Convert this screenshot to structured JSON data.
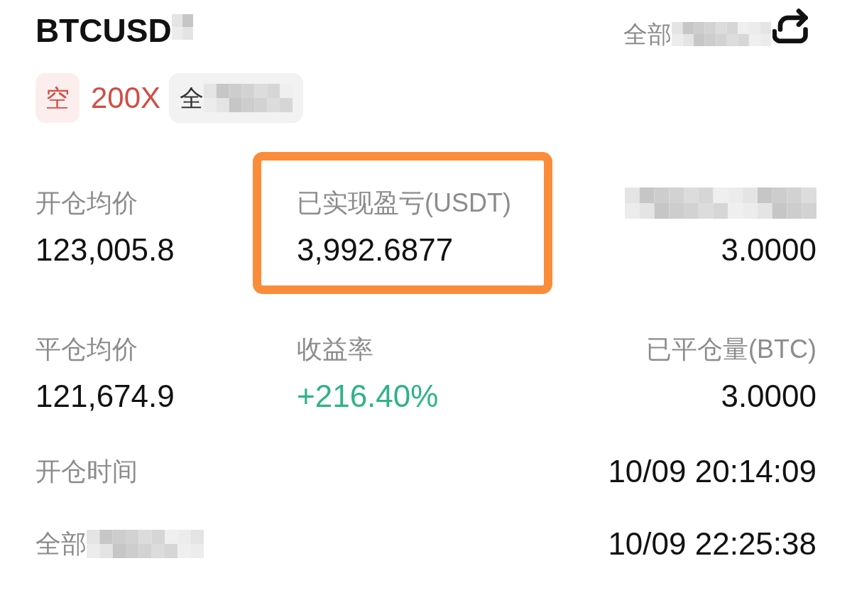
{
  "header": {
    "symbol": "BTCUSD",
    "symbol_redacted": true,
    "filter": "全部",
    "filter_redacted": true
  },
  "tags": [
    {
      "kind": "side",
      "text": "空"
    },
    {
      "kind": "leverage",
      "text": "200X"
    },
    {
      "kind": "margin",
      "text": "全",
      "redacted": true
    }
  ],
  "stats": [
    {
      "label": "开仓均价",
      "value": "123,005.8",
      "highlighted": false,
      "color": "#111111"
    },
    {
      "label": "已实现盈亏(USDT)",
      "value": "3,992.6877",
      "highlighted": true,
      "color": "#111111"
    },
    {
      "redacted": true,
      "value": "3.0000",
      "highlighted": false,
      "color": "#111111"
    },
    {
      "label": "平仓均价",
      "value": "121,674.9",
      "highlighted": false,
      "color": "#111111"
    },
    {
      "label": "收益率",
      "value": "+216.40%",
      "highlighted": false,
      "color": "#2fb386"
    },
    {
      "label": "已平仓量(BTC)",
      "value": "3.0000",
      "highlighted": false,
      "color": "#111111"
    }
  ],
  "times": [
    {
      "label": "开仓时间",
      "value": "10/09 20:14:09"
    },
    {
      "label": "全部",
      "redacted": true,
      "value": "10/09 22:25:38"
    }
  ]
}
